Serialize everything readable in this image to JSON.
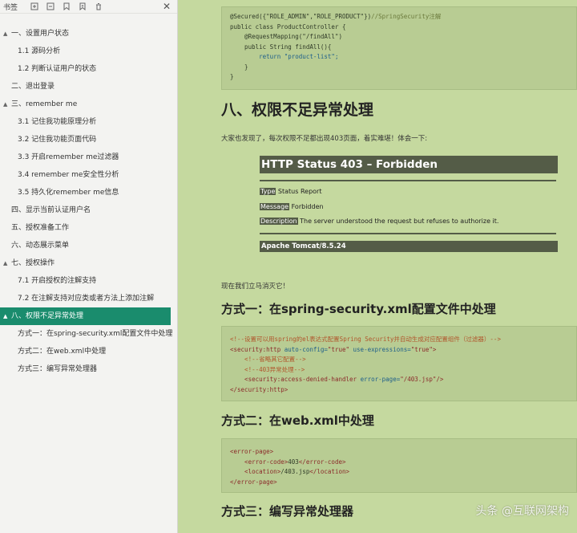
{
  "sidebar": {
    "title": "书签",
    "items": [
      {
        "label": "一、设置用户状态",
        "level": 1,
        "toggle": "▲",
        "active": false
      },
      {
        "label": "1.1 源码分析",
        "level": 2,
        "active": false
      },
      {
        "label": "1.2 判断认证用户的状态",
        "level": 2,
        "active": false
      },
      {
        "label": "二、退出登录",
        "level": 1,
        "active": false
      },
      {
        "label": "三、remember me",
        "level": 1,
        "toggle": "▲",
        "active": false
      },
      {
        "label": "3.1 记住我功能原理分析",
        "level": 2,
        "active": false
      },
      {
        "label": "3.2 记住我功能页面代码",
        "level": 2,
        "active": false
      },
      {
        "label": "3.3 开启remember me过滤器",
        "level": 2,
        "active": false
      },
      {
        "label": "3.4 remember me安全性分析",
        "level": 2,
        "active": false
      },
      {
        "label": "3.5 持久化remember me信息",
        "level": 2,
        "active": false
      },
      {
        "label": "四、显示当前认证用户名",
        "level": 1,
        "active": false
      },
      {
        "label": "五、授权准备工作",
        "level": 1,
        "active": false
      },
      {
        "label": "六、动态展示菜单",
        "level": 1,
        "active": false
      },
      {
        "label": "七、授权操作",
        "level": 1,
        "toggle": "▲",
        "active": false
      },
      {
        "label": "7.1 开启授权的注解支持",
        "level": 2,
        "active": false
      },
      {
        "label": "7.2 在注解支持对应类或者方法上添加注解",
        "level": 2,
        "active": false
      },
      {
        "label": "八、权限不足异常处理",
        "level": 1,
        "toggle": "▲",
        "active": true
      },
      {
        "label": "方式一：在spring-security.xml配置文件中处理",
        "level": 2,
        "active": false
      },
      {
        "label": "方式二：在web.xml中处理",
        "level": 2,
        "active": false
      },
      {
        "label": "方式三：编写异常处理器",
        "level": 2,
        "active": false
      }
    ]
  },
  "code1": {
    "l1a": "@Secured({\"ROLE_ADMIN\",\"ROLE_PRODUCT\"})",
    "l1b": "//SpringSecurity注解",
    "l2": "public class ProductController {",
    "l3": "    @RequestMapping(\"/findAll\")",
    "l4": "    public String findAll(){",
    "l5": "        return \"product-list\";",
    "l6": "    }",
    "l7": "}"
  },
  "heading8": "八、权限不足异常处理",
  "intro": "大家也发现了，每次权限不足都出现403页面，着实难堪！体会一下:",
  "error_page": {
    "title": "HTTP Status 403 – Forbidden",
    "type_label": "Type",
    "type_value": "Status Report",
    "message_label": "Message",
    "message_value": "Forbidden",
    "desc_label": "Description",
    "desc_value": "The server understood the request but refuses to authorize it.",
    "footer": "Apache Tomcat/8.5.24"
  },
  "transition": "现在我们立马消灭它！",
  "method1": {
    "heading": "方式一：在spring-security.xml配置文件中处理",
    "l1": "<!--设置可以用spring的el表达式配置Spring Security并自动生成对应配置组件（过滤器）-->",
    "l2a": "<security:http ",
    "l2b": "auto-config=",
    "l2c": "\"true\"",
    "l2d": " use-expressions=",
    "l2e": "\"true\"",
    "l2f": ">",
    "l3": "    <!--省略其它配置-->",
    "l4": "    <!--403异常处理-->",
    "l5a": "    <security:access-denied-handler ",
    "l5b": "error-page=",
    "l5c": "\"/403.jsp\"",
    "l5d": "/>",
    "l6": "</security:http>"
  },
  "method2": {
    "heading": "方式二：在web.xml中处理",
    "l1": "<error-page>",
    "l2a": "    <error-code>",
    "l2b": "403",
    "l2c": "</error-code>",
    "l3a": "    <location>",
    "l3b": "/403.jsp",
    "l3c": "</location>",
    "l4": "</error-page>"
  },
  "method3": {
    "heading": "方式三：编写异常处理器"
  },
  "watermark": "头条 @互联网架构"
}
